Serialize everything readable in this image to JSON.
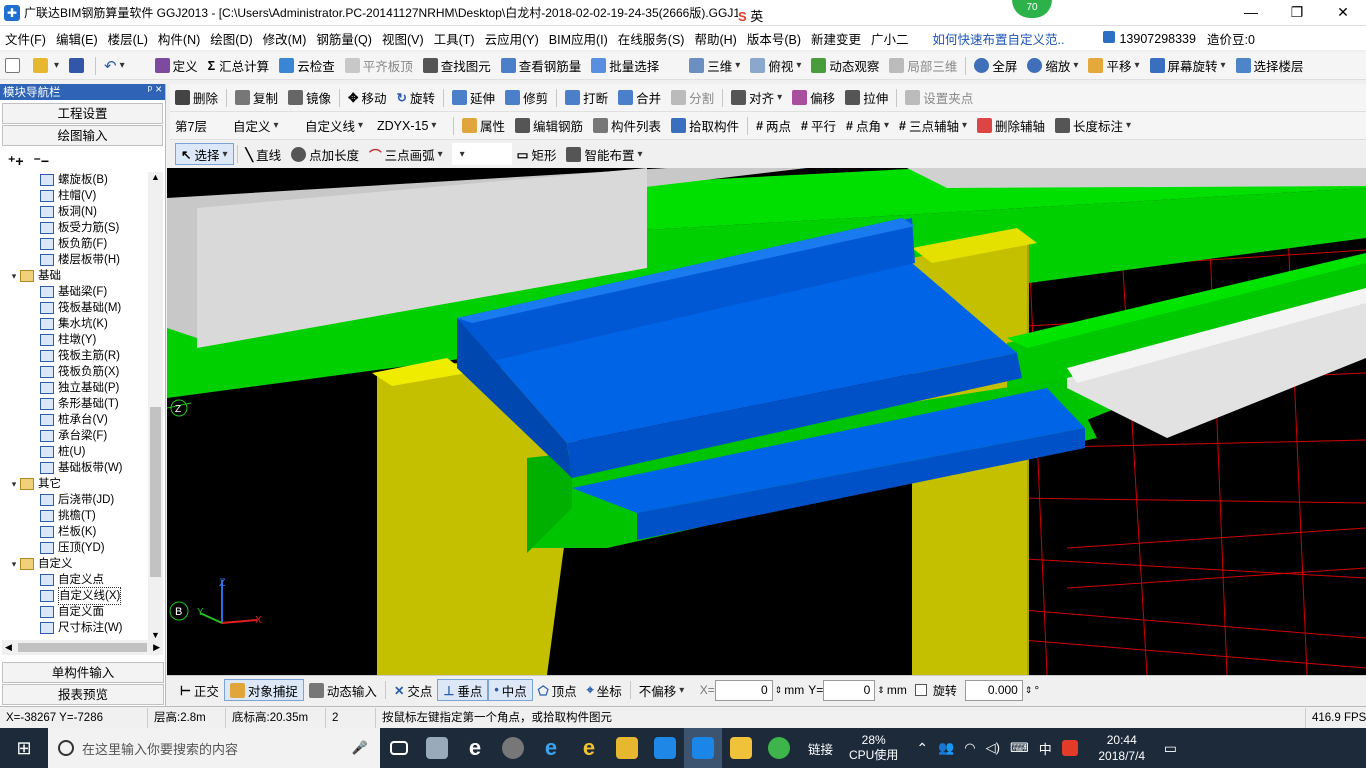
{
  "window": {
    "title": "广联达BIM钢筋算量软件 GGJ2013 - [C:\\Users\\Administrator.PC-20141127NRHM\\Desktop\\白龙村-2018-02-02-19-24-35(2666版).GGJ12]",
    "badge": "70",
    "ime_label": "英",
    "controls": [
      "—",
      "❐",
      "✕"
    ]
  },
  "menu": {
    "items": [
      "文件(F)",
      "编辑(E)",
      "楼层(L)",
      "构件(N)",
      "绘图(D)",
      "修改(M)",
      "钢筋量(Q)",
      "视图(V)",
      "工具(T)",
      "云应用(Y)",
      "BIM应用(I)",
      "在线服务(S)",
      "帮助(H)",
      "版本号(B)",
      "新建变更",
      "广小二"
    ],
    "link": "如何快速布置自定义范..",
    "phone": "13907298339",
    "price": "造价豆:0"
  },
  "toolbar1": {
    "items": [
      "定义",
      "汇总计算",
      "云检查",
      "平齐板顶",
      "查找图元",
      "查看钢筋量",
      "批量选择",
      "三维",
      "俯视",
      "动态观察",
      "局部三维",
      "全屏",
      "缩放",
      "平移",
      "屏幕旋转",
      "选择楼层"
    ]
  },
  "toolbar2": {
    "items": [
      "删除",
      "复制",
      "镜像",
      "移动",
      "旋转",
      "延伸",
      "修剪",
      "打断",
      "合并",
      "分割",
      "对齐",
      "偏移",
      "拉伸",
      "设置夹点"
    ]
  },
  "toolbar3": {
    "floor": "第7层",
    "type": "自定义",
    "sub": "自定义线",
    "code": "ZDYX-15",
    "items": [
      "属性",
      "编辑钢筋",
      "构件列表",
      "拾取构件",
      "两点",
      "平行",
      "点角",
      "三点辅轴",
      "删除辅轴",
      "长度标注"
    ]
  },
  "toolbar4": {
    "items": [
      "选择",
      "直线",
      "点加长度",
      "三点画弧",
      "矩形",
      "智能布置"
    ]
  },
  "nav": {
    "title": "模块导航栏",
    "pin": "ᵖ ×",
    "engineering": "工程设置",
    "drawing": "绘图输入",
    "single": "单构件输入",
    "report": "报表预览"
  },
  "tree": [
    {
      "label": "螺旋板(B)",
      "lvl": 2
    },
    {
      "label": "柱帽(V)",
      "lvl": 2
    },
    {
      "label": "板洞(N)",
      "lvl": 2
    },
    {
      "label": "板受力筋(S)",
      "lvl": 2
    },
    {
      "label": "板负筋(F)",
      "lvl": 2
    },
    {
      "label": "楼层板带(H)",
      "lvl": 2
    },
    {
      "label": "基础",
      "lvl": 1,
      "exp": "▾"
    },
    {
      "label": "基础梁(F)",
      "lvl": 2
    },
    {
      "label": "筏板基础(M)",
      "lvl": 2
    },
    {
      "label": "集水坑(K)",
      "lvl": 2
    },
    {
      "label": "柱墩(Y)",
      "lvl": 2
    },
    {
      "label": "筏板主筋(R)",
      "lvl": 2
    },
    {
      "label": "筏板负筋(X)",
      "lvl": 2
    },
    {
      "label": "独立基础(P)",
      "lvl": 2
    },
    {
      "label": "条形基础(T)",
      "lvl": 2
    },
    {
      "label": "桩承台(V)",
      "lvl": 2
    },
    {
      "label": "承台梁(F)",
      "lvl": 2
    },
    {
      "label": "桩(U)",
      "lvl": 2
    },
    {
      "label": "基础板带(W)",
      "lvl": 2
    },
    {
      "label": "其它",
      "lvl": 1,
      "exp": "▾"
    },
    {
      "label": "后浇带(JD)",
      "lvl": 2
    },
    {
      "label": "挑檐(T)",
      "lvl": 2
    },
    {
      "label": "栏板(K)",
      "lvl": 2
    },
    {
      "label": "压顶(YD)",
      "lvl": 2
    },
    {
      "label": "自定义",
      "lvl": 1,
      "exp": "▾"
    },
    {
      "label": "自定义点",
      "lvl": 2
    },
    {
      "label": "自定义线(X)",
      "lvl": 2,
      "sel": true
    },
    {
      "label": "自定义面",
      "lvl": 2
    },
    {
      "label": "尺寸标注(W)",
      "lvl": 2
    }
  ],
  "canvas": {
    "axis_labels": [
      "Z",
      "B",
      "Y",
      "X",
      "Z"
    ],
    "colors": {
      "beam": "#00d400",
      "column": "#c4c000",
      "slab": "#0062e0",
      "wall": "#d8d8d8",
      "grid": "#e00000"
    }
  },
  "snap": {
    "items": [
      "正交",
      "对象捕捉",
      "动态输入",
      "交点",
      "垂点",
      "中点",
      "顶点",
      "坐标"
    ],
    "offset": "不偏移",
    "x_label": "X=",
    "x_value": "0",
    "y_label": "Y=",
    "y_value": "0",
    "unit": "mm",
    "rotate_label": "旋转",
    "rotate_value": "0.000",
    "degree": "°"
  },
  "status": {
    "coords": "X=-38267 Y=-7286",
    "floor_height": "层高:2.8m",
    "base_height": "底标高:20.35m",
    "count": "2",
    "hint": "按鼠标左键指定第一个角点，或拾取构件图元",
    "fps": "416.9 FPS"
  },
  "taskbar": {
    "search": "在这里输入你要搜索的内容",
    "link": "链接",
    "cpu_pct": "28%",
    "cpu_label": "CPU使用",
    "ime": "中",
    "time": "20:44",
    "date": "2018/7/4"
  }
}
